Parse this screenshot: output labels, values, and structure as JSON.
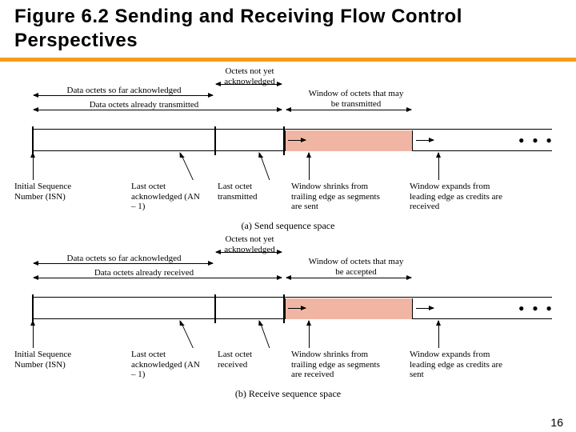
{
  "title": "Figure 6.2 Sending and Receiving Flow Control Perspectives",
  "page_number": "16",
  "panel_a": {
    "caption": "(a) Send sequence space",
    "top_label_ack": "Data octets so far acknowledged",
    "top_label_tx": "Data octets already transmitted",
    "top_label_unack": "Octets not yet acknowledged",
    "top_label_window": "Window of octets that may be transmitted",
    "bottom_isn": "Initial Sequence Number (ISN)",
    "bottom_lastack": "Last octet acknowledged (AN – 1)",
    "bottom_lasttx": "Last octet transmitted",
    "bottom_shrink": "Window shrinks from trailing edge as segments are sent",
    "bottom_expand": "Window expands from leading edge as credits are received"
  },
  "panel_b": {
    "caption": "(b) Receive sequence space",
    "top_label_ack": "Data octets so far acknowledged",
    "top_label_rx": "Data octets already received",
    "top_label_unack": "Octets not yet acknowledged",
    "top_label_window": "Window of octets that may be accepted",
    "bottom_isn": "Initial Sequence Number (ISN)",
    "bottom_lastack": "Last octet acknowledged (AN – 1)",
    "bottom_lastrx": "Last octet received",
    "bottom_shrink": "Window shrinks from trailing edge as segments are received",
    "bottom_expand": "Window expands from leading edge as credits are sent"
  },
  "dots": "•  •  •"
}
